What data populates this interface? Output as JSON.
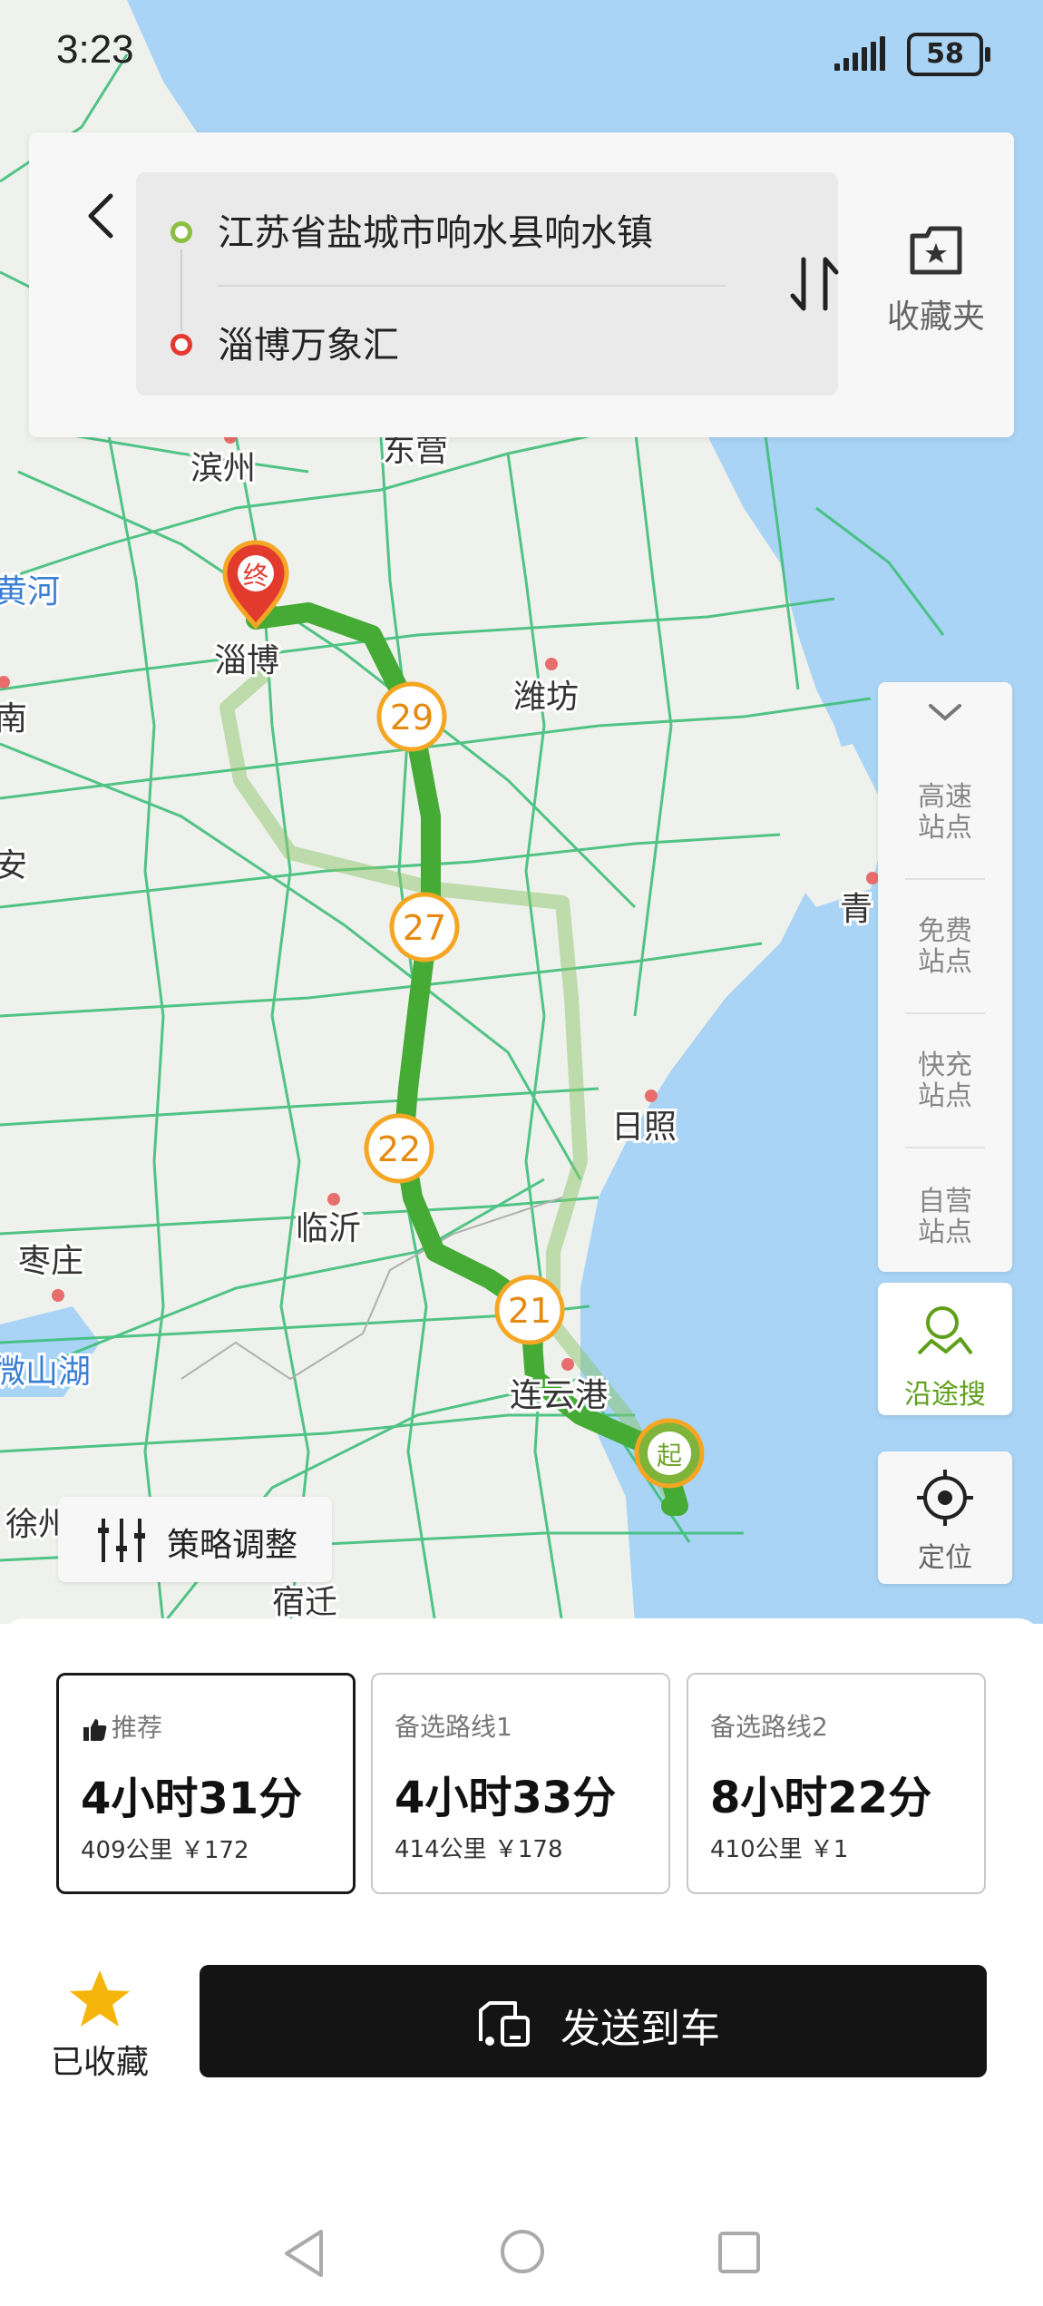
{
  "status": {
    "time": "3:23",
    "battery": "58"
  },
  "search": {
    "start": "江苏省盐城市响水县响水镇",
    "end": "淄博万象汇",
    "favorites_label": "收藏夹"
  },
  "map": {
    "cities": [
      "滨州",
      "东营",
      "黄河",
      "淄博",
      "潍坊",
      "南",
      "安",
      "青",
      "日照",
      "临沂",
      "枣庄",
      "微山湖",
      "连云港",
      "徐州",
      "宿迁"
    ],
    "markers": {
      "end": "终",
      "start": "起"
    },
    "badges": [
      "29",
      "27",
      "22",
      "21"
    ]
  },
  "side_panel": {
    "items": [
      "高速站点",
      "免费站点",
      "快充站点",
      "自营站点"
    ],
    "search_label": "沿途搜",
    "locate_label": "定位"
  },
  "strategy_label": "策略调整",
  "routes": [
    {
      "tag": "推荐",
      "duration": "4小时31分",
      "meta": "409公里 ￥172",
      "selected": true
    },
    {
      "tag": "备选路线1",
      "duration": "4小时33分",
      "meta": "414公里 ￥178",
      "selected": false
    },
    {
      "tag": "备选路线2",
      "duration": "8小时22分",
      "meta": "410公里 ￥1",
      "selected": false
    }
  ],
  "favorite_label": "已收藏",
  "send_label": "发送到车"
}
